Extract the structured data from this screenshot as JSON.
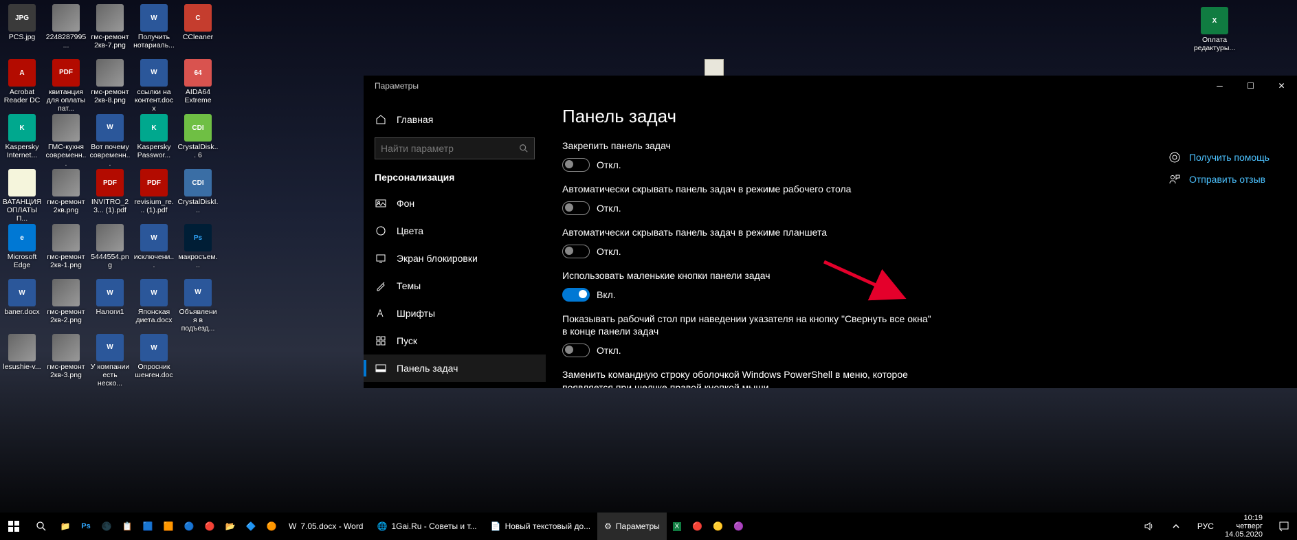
{
  "desktop_icons": [
    [
      {
        "label": "PCS.jpg",
        "cls": "i-jpg",
        "t": "JPG"
      },
      {
        "label": "2248287995...",
        "cls": "i-img",
        "t": ""
      },
      {
        "label": "гмс-ремонт 2кв-7.png",
        "cls": "i-img",
        "t": ""
      },
      {
        "label": "Получить нотариаль...",
        "cls": "i-word",
        "t": "W"
      },
      {
        "label": "CCleaner",
        "cls": "i-cc",
        "t": "C"
      }
    ],
    [
      {
        "label": "Acrobat Reader DC",
        "cls": "i-pdf",
        "t": "A"
      },
      {
        "label": "квитанция для оплаты пат...",
        "cls": "i-pdf",
        "t": "PDF"
      },
      {
        "label": "гмс-ремонт 2кв-8.png",
        "cls": "i-img",
        "t": ""
      },
      {
        "label": "ссылки на контент.docx",
        "cls": "i-word",
        "t": "W"
      },
      {
        "label": "AIDA64 Extreme",
        "cls": "i-aida",
        "t": "64"
      }
    ],
    [
      {
        "label": "Kaspersky Internet...",
        "cls": "i-kasp",
        "t": "K"
      },
      {
        "label": "ГМС-кухня современн...",
        "cls": "i-img",
        "t": ""
      },
      {
        "label": "Вот почему современн...",
        "cls": "i-word",
        "t": "W"
      },
      {
        "label": "Kaspersky Passwor...",
        "cls": "i-kasp",
        "t": "K"
      },
      {
        "label": "CrystalDisk... 6",
        "cls": "i-cdi",
        "t": "CDI"
      }
    ],
    [
      {
        "label": "ВАТАНЦИЯ ОПЛАТЫ П...",
        "cls": "i-txt",
        "t": ""
      },
      {
        "label": "гмс-ремонт 2кв.png",
        "cls": "i-img",
        "t": ""
      },
      {
        "label": "INVITRO_23... (1).pdf",
        "cls": "i-pdf",
        "t": "PDF"
      },
      {
        "label": "revisium_re... (1).pdf",
        "cls": "i-pdf",
        "t": "PDF"
      },
      {
        "label": "CrystalDiskI...",
        "cls": "i-cdis",
        "t": "CDI"
      }
    ],
    [
      {
        "label": "Microsoft Edge",
        "cls": "i-edge",
        "t": "e"
      },
      {
        "label": "гмс-ремонт 2кв-1.png",
        "cls": "i-img",
        "t": ""
      },
      {
        "label": "5444554.png",
        "cls": "i-img",
        "t": ""
      },
      {
        "label": "исключени...",
        "cls": "i-word",
        "t": "W"
      },
      {
        "label": "макросъем...",
        "cls": "i-ps",
        "t": "Ps"
      }
    ],
    [
      {
        "label": "baner.docx",
        "cls": "i-word",
        "t": "W"
      },
      {
        "label": "гмс-ремонт 2кв-2.png",
        "cls": "i-img",
        "t": ""
      },
      {
        "label": "Налоги1",
        "cls": "i-word",
        "t": "W"
      },
      {
        "label": "Японская диета.docx",
        "cls": "i-word",
        "t": "W"
      },
      {
        "label": "Объявления в подъезд...",
        "cls": "i-word",
        "t": "W"
      }
    ],
    [
      {
        "label": "lesushie-v...",
        "cls": "i-img",
        "t": ""
      },
      {
        "label": "гмс-ремонт 2кв-3.png",
        "cls": "i-img",
        "t": ""
      },
      {
        "label": "У компании есть неско...",
        "cls": "i-word",
        "t": "W"
      },
      {
        "label": "Опросник шенген.doc",
        "cls": "i-word",
        "t": "W"
      }
    ]
  ],
  "excel_icon": {
    "label": "Оплата редактуры...",
    "t": "X"
  },
  "settings": {
    "window_title": "Параметры",
    "home": "Главная",
    "search_placeholder": "Найти параметр",
    "section": "Персонализация",
    "nav": [
      {
        "key": "background",
        "label": "Фон"
      },
      {
        "key": "colors",
        "label": "Цвета"
      },
      {
        "key": "lockscreen",
        "label": "Экран блокировки"
      },
      {
        "key": "themes",
        "label": "Темы"
      },
      {
        "key": "fonts",
        "label": "Шрифты"
      },
      {
        "key": "start",
        "label": "Пуск"
      },
      {
        "key": "taskbar",
        "label": "Панель задач"
      }
    ],
    "page_title": "Панель задач",
    "help": {
      "get_help": "Получить помощь",
      "feedback": "Отправить отзыв"
    },
    "state_on": "Вкл.",
    "state_off": "Откл.",
    "options": [
      {
        "label": "Закрепить панель задач",
        "on": false
      },
      {
        "label": "Автоматически скрывать панель задач в режиме рабочего стола",
        "on": false
      },
      {
        "label": "Автоматически скрывать панель задач в режиме планшета",
        "on": false
      },
      {
        "label": "Использовать маленькие кнопки панели задач",
        "on": true
      },
      {
        "label": "Показывать рабочий стол при наведении указателя на кнопку \"Свернуть все окна\" в конце панели задач",
        "on": false
      },
      {
        "label": "Заменить командную строку оболочкой Windows PowerShell в меню, которое появляется при щелчке правой кнопкой мыши",
        "on": null
      }
    ]
  },
  "taskbar": {
    "tasks": [
      {
        "label": "7.05.docx - Word",
        "cls": "i-word",
        "t": "W"
      },
      {
        "label": "1Gai.Ru - Советы и т...",
        "cls": "",
        "t": "🌐"
      },
      {
        "label": "Новый текстовый до...",
        "cls": "",
        "t": "📄"
      },
      {
        "label": "Параметры",
        "cls": "",
        "t": "⚙",
        "active": true
      }
    ],
    "lang": "РУС",
    "time": "10:19",
    "day": "четверг",
    "date": "14.05.2020"
  }
}
